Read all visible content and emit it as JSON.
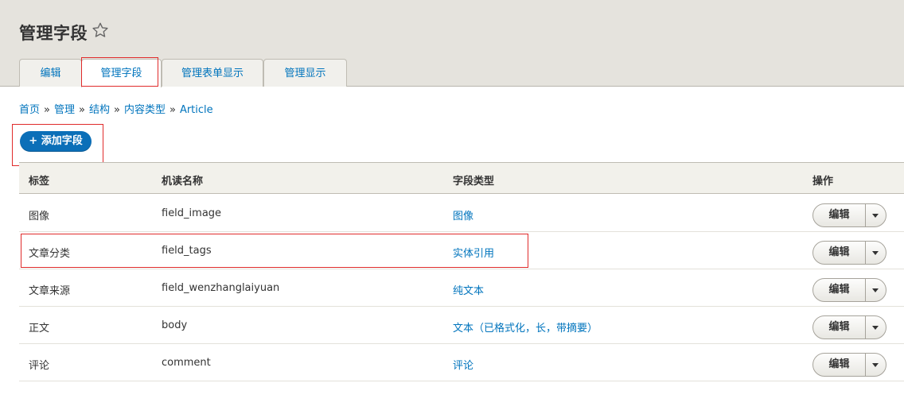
{
  "page_title": "管理字段",
  "tabs": [
    {
      "label": "编辑"
    },
    {
      "label": "管理字段"
    },
    {
      "label": "管理表单显示"
    },
    {
      "label": "管理显示"
    }
  ],
  "breadcrumb": {
    "items": [
      "首页",
      "管理",
      "结构",
      "内容类型",
      "Article"
    ],
    "separator": "»"
  },
  "add_field_button": "+ 添加字段",
  "table": {
    "headers": [
      "标签",
      "机读名称",
      "字段类型",
      "操作"
    ],
    "rows": [
      {
        "label": "图像",
        "machine_name": "field_image",
        "type": "图像",
        "op": "编辑"
      },
      {
        "label": "文章分类",
        "machine_name": "field_tags",
        "type": "实体引用",
        "op": "编辑"
      },
      {
        "label": "文章来源",
        "machine_name": "field_wenzhanglaiyuan",
        "type": "纯文本",
        "op": "编辑"
      },
      {
        "label": "正文",
        "machine_name": "body",
        "type": "文本（已格式化，长，带摘要）",
        "op": "编辑"
      },
      {
        "label": "评论",
        "machine_name": "comment",
        "type": "评论",
        "op": "编辑"
      }
    ]
  },
  "colors": {
    "link": "#0074bd",
    "primary_button": "#0b6fb8",
    "highlight_box": "#e02b2b",
    "header_bg": "#e5e3dd"
  },
  "icons": {
    "favorite": "star-outline-icon",
    "dropbutton_toggle": "chevron-down-icon"
  }
}
